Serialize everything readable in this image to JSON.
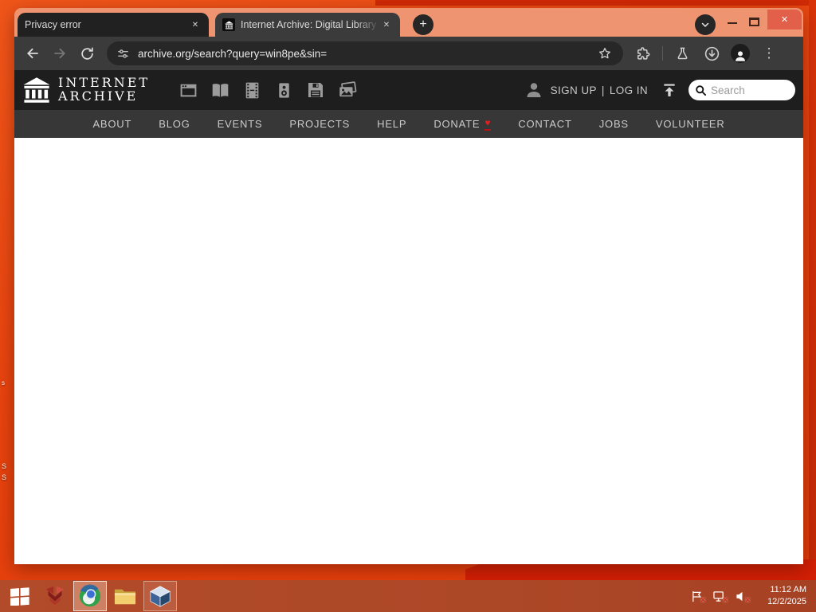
{
  "browser": {
    "tabs": [
      {
        "title": "Privacy error"
      },
      {
        "title": "Internet Archive: Digital Library"
      }
    ],
    "url": "archive.org/search?query=win8pe&sin="
  },
  "glyphs": {
    "close": "✕",
    "plus": "+",
    "kebab": "⋮",
    "heart": "♥",
    "tray_x": "✕"
  },
  "icons": {
    "back": "arrow-left",
    "forward": "arrow-right",
    "reload": "circular-arrow",
    "site_info": "tune-sliders",
    "bookmark": "star-outline",
    "extensions": "puzzle-piece",
    "labs": "flask",
    "downloads": "circle-down-arrow",
    "profile": "person-silhouette",
    "menu": "kebab-dots",
    "tab_search": "chevron-down",
    "new_tab": "plus-circle",
    "ia_logo": "greek-building",
    "upload": "arrow-up-with-bar",
    "search": "magnifier",
    "media_web": "browser-window",
    "media_texts": "open-book",
    "media_video": "film-strip",
    "media_audio": "speaker-box",
    "media_software": "floppy-disk",
    "media_images": "photo-stack",
    "start": "windows-flag",
    "app_red": "red-geometric-app",
    "app_chromium": "chromium-globe",
    "app_explorer": "yellow-folder",
    "app_virtualbox": "blue-cube",
    "tray_flag": "flag-with-x",
    "tray_network": "monitor-with-x",
    "tray_audio": "speaker-with-x"
  },
  "ia": {
    "logo": {
      "line1": "INTERNET",
      "line2": "ARCHIVE"
    },
    "auth": {
      "sign_up": "SIGN UP",
      "separator": "|",
      "log_in": "LOG IN"
    },
    "search_placeholder": "Search",
    "nav": [
      {
        "label": "ABOUT"
      },
      {
        "label": "BLOG"
      },
      {
        "label": "EVENTS"
      },
      {
        "label": "PROJECTS"
      },
      {
        "label": "HELP"
      },
      {
        "label": "DONATE"
      },
      {
        "label": "CONTACT"
      },
      {
        "label": "JOBS"
      },
      {
        "label": "VOLUNTEER"
      }
    ],
    "media_types": [
      "web",
      "texts",
      "video",
      "audio",
      "software",
      "images"
    ]
  },
  "taskbar": {
    "clock": {
      "time": "11:12 AM",
      "date": "12/2/2025"
    }
  },
  "desktop": {
    "icon_label_fragments": [
      "s",
      "S",
      "S"
    ]
  },
  "colors": {
    "frame_salmon": "#ef9470",
    "desktop_orange": "#e8430e",
    "desktop_dark_red": "#d21f05",
    "taskbar": "#ad4827",
    "toolbar_dark": "#3b3b3b",
    "tab_inactive": "#212121",
    "ia_header": "#1e1e1e",
    "ia_nav": "#373737",
    "close_button_red": "#e2604a",
    "donate_heart_red": "#e01f1f"
  }
}
